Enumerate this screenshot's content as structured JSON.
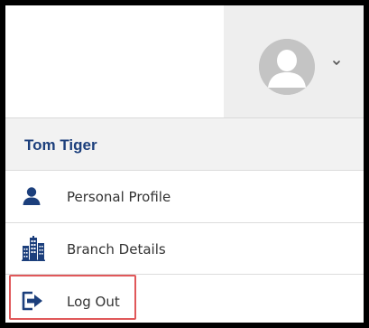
{
  "user": {
    "name": "Tom Tiger"
  },
  "menu": {
    "items": [
      {
        "label": "Personal Profile",
        "icon": "person-icon"
      },
      {
        "label": "Branch Details",
        "icon": "buildings-icon"
      },
      {
        "label": "Log Out",
        "icon": "logout-icon"
      }
    ]
  },
  "colors": {
    "name_text": "#1c3f7c",
    "icon": "#1c3f7c",
    "highlight_border": "#e0585a",
    "avatar_bg": "#c4c4c4",
    "header_bg": "#eeeeee"
  }
}
